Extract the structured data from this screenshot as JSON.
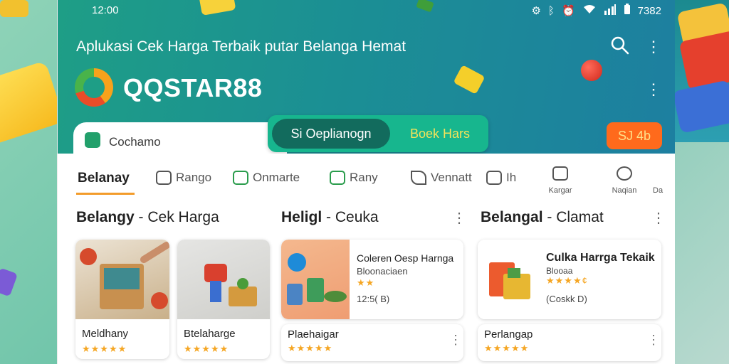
{
  "status_bar": {
    "time": "12:00",
    "battery": "7382"
  },
  "header": {
    "tagline": "Aplukasi Cek Harga Terbaik putar Belanga Hemat",
    "logo_text": "QQSTAR88",
    "current_tab_label": "Cochamo",
    "toggle": {
      "left_label": "Si Oeplianogn",
      "right_label": "Boek Hars"
    },
    "chip_label": "SJ 4b"
  },
  "nav": {
    "items": [
      {
        "label": "Belanay"
      },
      {
        "label": "Rango"
      },
      {
        "label": "Onmarte"
      },
      {
        "label": "Rany"
      },
      {
        "label": "Vennatt"
      },
      {
        "label": "Ih"
      }
    ],
    "small_items": [
      {
        "label": "Kargar"
      },
      {
        "label": "Naqian"
      },
      {
        "label": "Da"
      }
    ]
  },
  "sections": [
    {
      "title": "Belangy",
      "subtitle": "Cek Harga"
    },
    {
      "title": "Heligl",
      "subtitle": "Ceuka"
    },
    {
      "title": "Belangal",
      "subtitle": "Clamat"
    }
  ],
  "cards": [
    {
      "name": "Meldhany",
      "rating": "★★★★★"
    },
    {
      "name": "Btelaharge",
      "rating": "★★★★★"
    },
    {
      "name": "Coleren Oesp Harnga",
      "sub": "Bloonaciaen",
      "rating": "★★",
      "price": "12:5( B)"
    },
    {
      "name": "Plaehaigar",
      "rating": "★★★★★"
    },
    {
      "name": "Culka Harrga Tekaik",
      "sub": "Blooaa",
      "rating": "★★★★¢",
      "price": "(Coskk D)"
    },
    {
      "name": "Perlangap",
      "rating": "★★★★★"
    }
  ],
  "colors": {
    "header_start": "#1e9e86",
    "header_end": "#1d7fa0",
    "accent_orange": "#ff6a1c",
    "toggle_green": "#17b68e",
    "toggle_dark": "#126b5d",
    "star": "#f5a623"
  }
}
